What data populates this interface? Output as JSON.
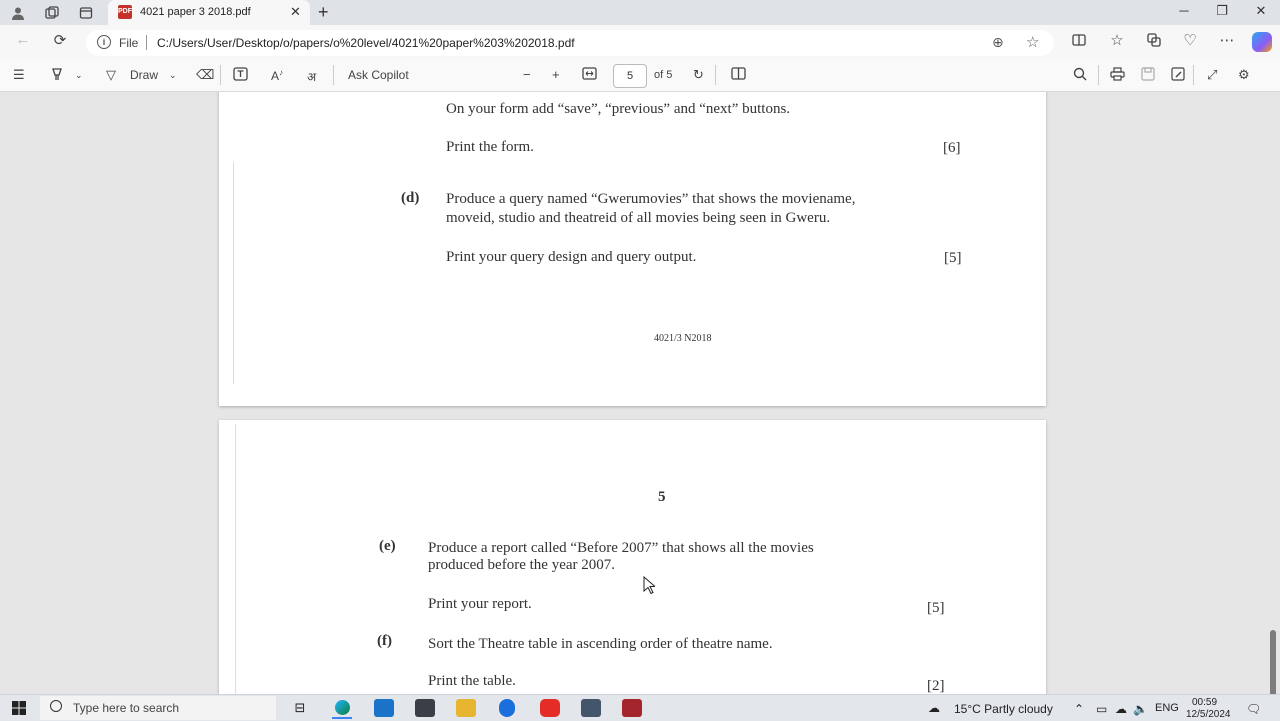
{
  "browser": {
    "tab_title": "4021 paper 3 2018.pdf",
    "file_label": "File",
    "url": "C:/Users/User/Desktop/o/papers/o%20level/4021%20paper%203%202018.pdf"
  },
  "pdf_toolbar": {
    "draw_label": "Draw",
    "ask_copilot": "Ask Copilot",
    "page_current": "5",
    "page_total": "of 5"
  },
  "page4": {
    "line_form_buttons": "On your form add “save”, “previous” and “next” buttons.",
    "line_print_form": "Print the form.",
    "mark_c": "[6]",
    "label_d": "(d)",
    "d_text_1": "Produce a query named “Gwerumovies” that shows the moviename,",
    "d_text_2": "moveid, studio and theatreid of all movies being seen in Gweru.",
    "d_print": "Print your query design and query output.",
    "mark_d": "[5]",
    "footer": "4021/3 N2018"
  },
  "page5": {
    "page_number": "5",
    "label_e": "(e)",
    "e_text_1": "Produce a report called “Before 2007” that shows all the movies",
    "e_text_2": "produced before the year 2007.",
    "e_print": "Print your report.",
    "mark_e": "[5]",
    "label_f": "(f)",
    "f_text": "Sort the Theatre table in ascending order of theatre name.",
    "f_print": "Print the table.",
    "mark_f": "[2]"
  },
  "taskbar": {
    "search_placeholder": "Type here to search",
    "weather": "15°C  Partly cloudy",
    "language": "ENG",
    "time": "00:59",
    "date": "12/5/2024"
  }
}
